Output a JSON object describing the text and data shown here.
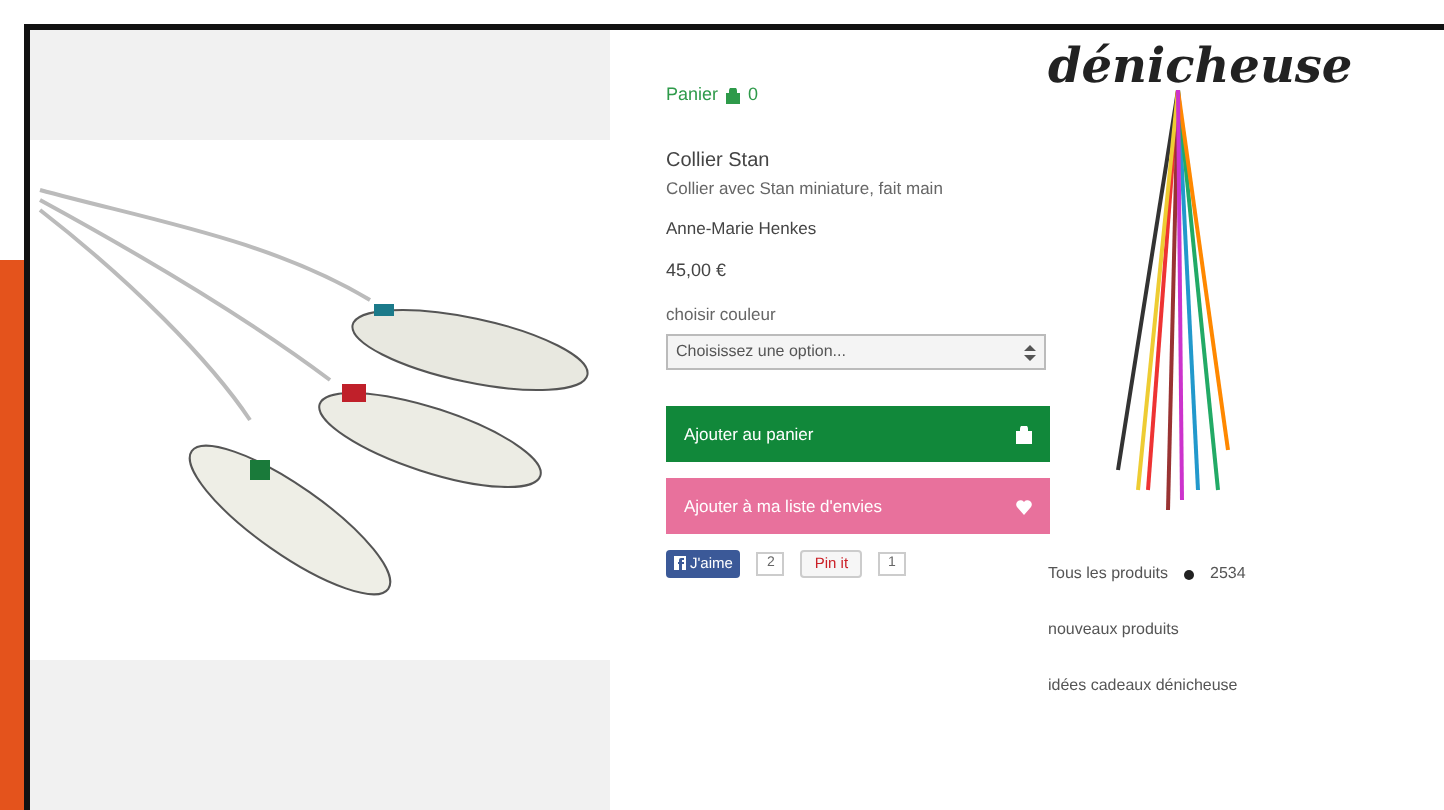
{
  "cart": {
    "label": "Panier",
    "count": "0"
  },
  "product": {
    "title": "Collier Stan",
    "description": "Collier avec Stan miniature, fait main",
    "maker": "Anne-Marie Henkes",
    "price": "45,00 €",
    "option_label": "choisir couleur",
    "option_select": {
      "value": "Choisissez une option..."
    }
  },
  "buttons": [
    {
      "kind": "cart",
      "label": "Ajouter au panier"
    },
    {
      "kind": "wishlist",
      "label": "Ajouter à ma liste d'envies"
    }
  ],
  "social": [
    {
      "kind": "like",
      "label": "J'aime",
      "count": "2"
    },
    {
      "kind": "pin",
      "label": "Pin it",
      "count": "1"
    }
  ],
  "brand": {
    "logo": "dénicheuse"
  },
  "sidebar": {
    "items": [
      {
        "label": "Tous les produits",
        "count": "2534"
      },
      {
        "label": "nouveaux produits"
      },
      {
        "label": "idées cadeaux dénicheuse"
      }
    ]
  }
}
